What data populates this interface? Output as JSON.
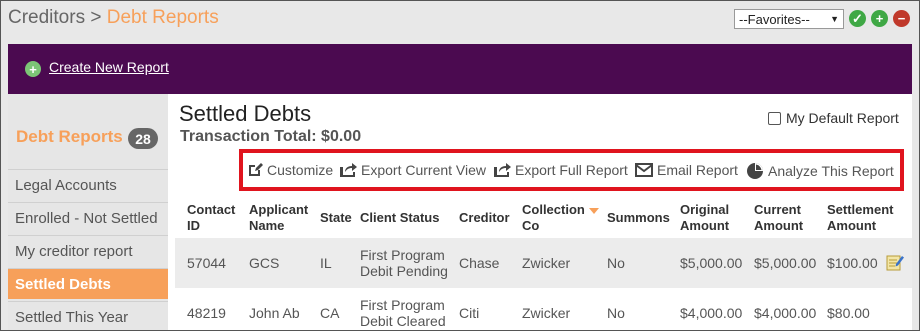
{
  "header": {
    "breadcrumb_root": "Creditors",
    "breadcrumb_sep": ">",
    "breadcrumb_current": "Debt Reports",
    "favorites_value": "--Favorites--",
    "ok_symbol": "✓",
    "add_symbol": "+",
    "remove_symbol": "−"
  },
  "banner": {
    "create_label": "Create New Report"
  },
  "sidebar": {
    "heading": "Debt Reports",
    "count": "28",
    "items": [
      {
        "label": "Legal Accounts",
        "active": false
      },
      {
        "label": "Enrolled - Not Settled",
        "active": false
      },
      {
        "label": "My creditor report",
        "active": false
      },
      {
        "label": "Settled Debts",
        "active": true
      },
      {
        "label": "Settled This Year",
        "active": false
      }
    ]
  },
  "main": {
    "title": "Settled Debts",
    "transaction_total": "Transaction Total: $0.00",
    "default_report_label": "My Default Report",
    "default_report_checked": false,
    "toolbar": {
      "customize": "Customize",
      "export_current": "Export Current View",
      "export_full": "Export Full Report",
      "email": "Email Report",
      "analyze": "Analyze This Report"
    },
    "table": {
      "headers": {
        "contact_id": [
          "Contact",
          "ID"
        ],
        "applicant_name": [
          "Applicant",
          "Name"
        ],
        "state": "State",
        "client_status": "Client Status",
        "creditor": "Creditor",
        "collection_co": [
          "Collection",
          "Co"
        ],
        "summons": "Summons",
        "original_amount": [
          "Original",
          "Amount"
        ],
        "current_amount": [
          "Current",
          "Amount"
        ],
        "settlement_amount": [
          "Settlement",
          "Amount"
        ]
      },
      "rows": [
        {
          "contact_id": "57044",
          "applicant_name": "GCS",
          "state": "IL",
          "client_status": [
            "First Program",
            "Debit Pending"
          ],
          "creditor": "Chase",
          "collection_co": "Zwicker",
          "summons": "No",
          "original_amount": "$5,000.00",
          "current_amount": "$5,000.00",
          "settlement_amount": "$100.00"
        },
        {
          "contact_id": "48219",
          "applicant_name": "John Ab",
          "state": "CA",
          "client_status": [
            "First Program",
            "Debit Cleared"
          ],
          "creditor": "Citi",
          "collection_co": "Zwicker",
          "summons": "No",
          "original_amount": "$4,000.00",
          "current_amount": "$4,000.00",
          "settlement_amount": "$80.00"
        }
      ]
    }
  },
  "colors": {
    "accent_orange": "#f7a05a",
    "banner_purple": "#4b0a50",
    "toolbar_highlight": "#e0141e",
    "ok_green": "#3fa845",
    "remove_red": "#c0392b"
  }
}
